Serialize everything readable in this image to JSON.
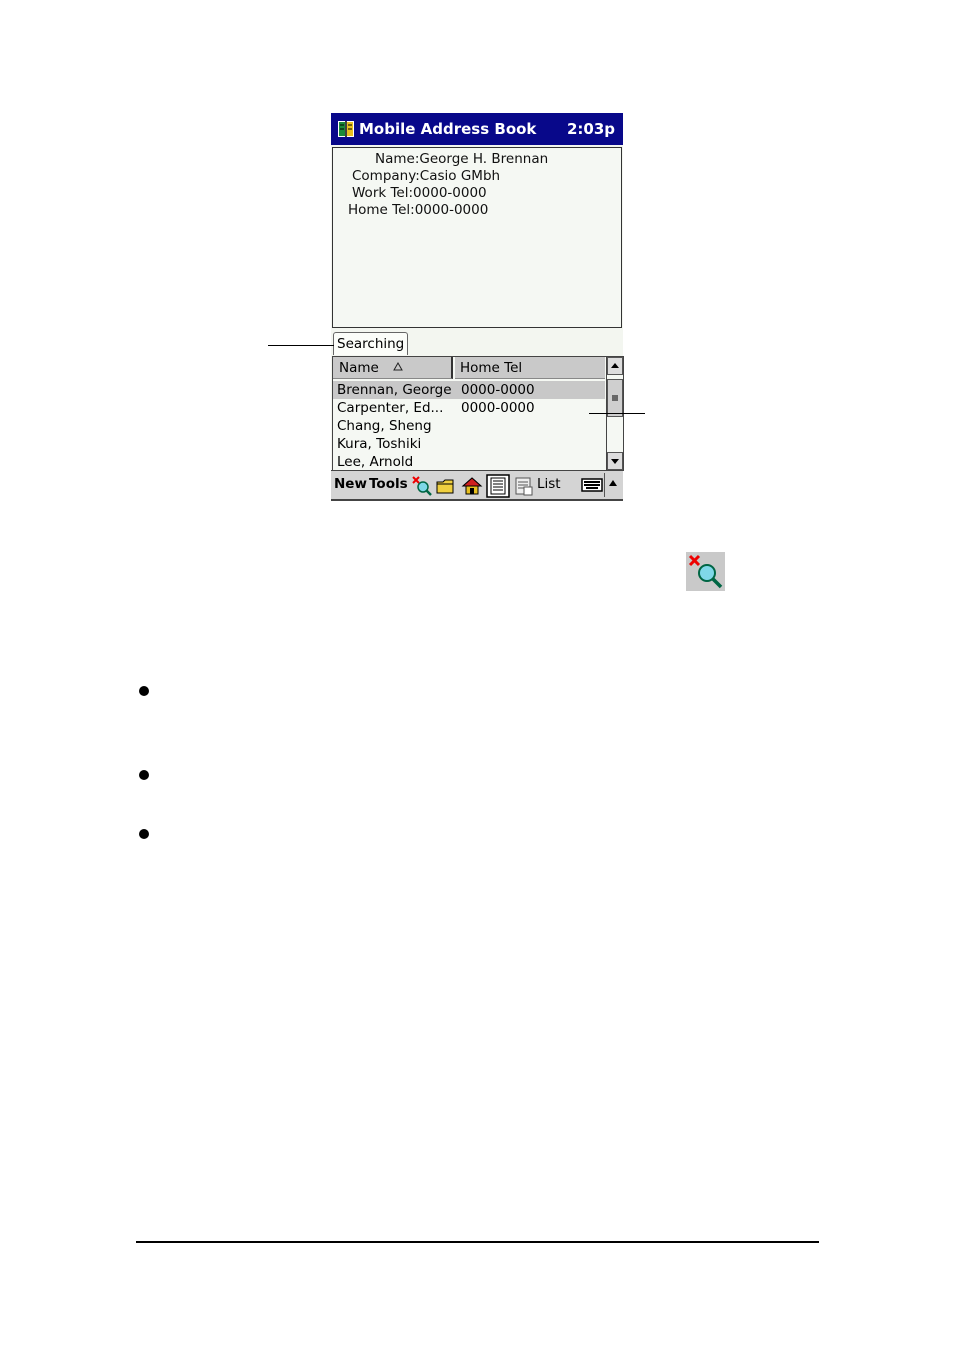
{
  "app": {
    "title": "Mobile Address Book",
    "time": "2:03p",
    "icon": "address-book-icon"
  },
  "detail": {
    "fields": [
      {
        "label": "Name:",
        "value": "George H. Brennan"
      },
      {
        "label": "Company:",
        "value": "Casio GMbh"
      },
      {
        "label": "Work Tel:",
        "value": "0000-0000"
      },
      {
        "label": "Home Tel:",
        "value": "0000-0000"
      }
    ]
  },
  "tab": {
    "label": "Searching"
  },
  "list": {
    "columns": [
      "Name",
      "Home Tel"
    ],
    "sort_indicator": "sort-ascending-icon",
    "rows": [
      {
        "name": "Brennan, George",
        "tel": "0000-0000",
        "selected": true
      },
      {
        "name": "Carpenter, Ed...",
        "tel": "0000-0000",
        "selected": false
      },
      {
        "name": "Chang, Sheng",
        "tel": "",
        "selected": false
      },
      {
        "name": "Kura, Toshiki",
        "tel": "",
        "selected": false
      },
      {
        "name": "Lee, Arnold",
        "tel": "",
        "selected": false
      }
    ]
  },
  "command_bar": {
    "new_label": "New",
    "tools_label": "Tools",
    "list_label": "List",
    "icons": [
      "clear-search-icon",
      "folder-icon",
      "home-icon",
      "detail-view-icon",
      "list-view-icon",
      "keyboard-icon",
      "up-arrow-icon"
    ]
  },
  "colors": {
    "titlebar": "#08088a",
    "selection": "#c8c8c8",
    "background": "#f3f6f0"
  }
}
